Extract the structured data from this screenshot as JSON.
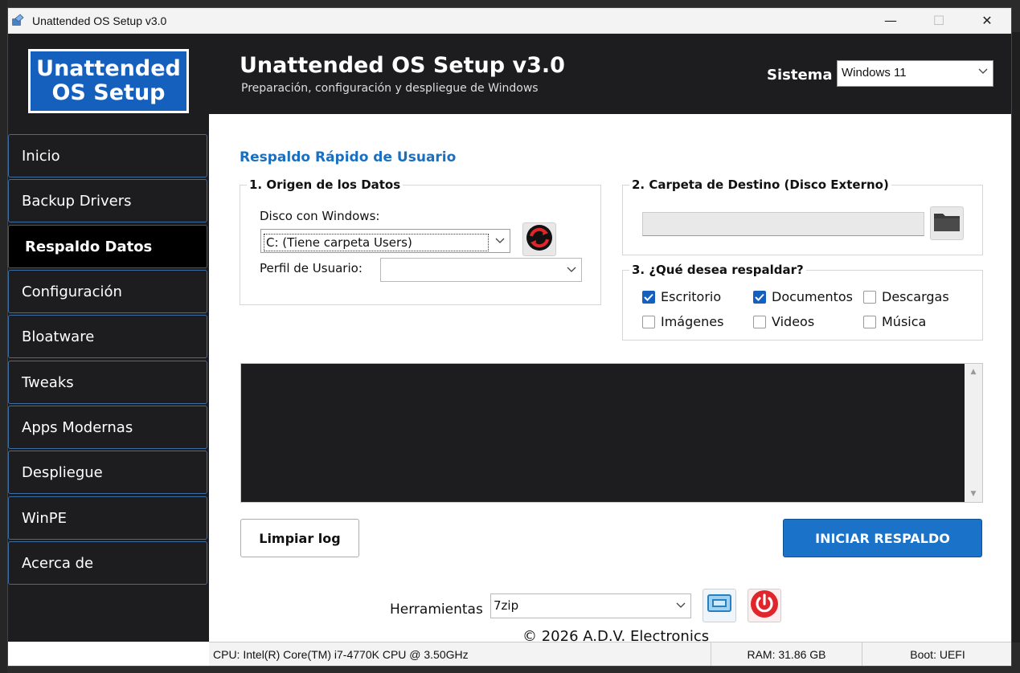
{
  "window": {
    "title": "Unattended OS Setup v3.0",
    "minimize_glyph": "—",
    "maximize_glyph": "☐",
    "close_glyph": "✕"
  },
  "header": {
    "logo_line1": "Unattended",
    "logo_line2": "OS Setup",
    "title": "Unattended OS Setup v3.0",
    "subtitle": "Preparación, configuración y despliegue de Windows",
    "system_label": "Sistema",
    "system_value": "Windows 11"
  },
  "sidebar": {
    "items": [
      {
        "label": "Inicio"
      },
      {
        "label": "Backup Drivers"
      },
      {
        "label": "Respaldo Datos"
      },
      {
        "label": "Configuración"
      },
      {
        "label": "Bloatware"
      },
      {
        "label": "Tweaks"
      },
      {
        "label": "Apps Modernas"
      },
      {
        "label": "Despliegue"
      },
      {
        "label": "WinPE"
      },
      {
        "label": "Acerca de"
      }
    ],
    "active_index": 2
  },
  "main": {
    "section_title": "Respaldo Rápido de Usuario",
    "origin": {
      "legend": "1. Origen de los Datos",
      "disk_label": "Disco con Windows:",
      "disk_value": "C: (Tiene carpeta Users)",
      "profile_label": "Perfil de Usuario:",
      "profile_value": ""
    },
    "destination": {
      "legend": "2. Carpeta de Destino (Disco Externo)",
      "path_value": ""
    },
    "what": {
      "legend": "3. ¿Qué desea respaldar?",
      "options": [
        {
          "label": "Escritorio",
          "checked": true
        },
        {
          "label": "Documentos",
          "checked": true
        },
        {
          "label": "Descargas",
          "checked": false
        },
        {
          "label": "Imágenes",
          "checked": false
        },
        {
          "label": "Videos",
          "checked": false
        },
        {
          "label": "Música",
          "checked": false
        }
      ]
    },
    "clear_log_label": "Limpiar log",
    "start_backup_label": "INICIAR RESPALDO",
    "tools_label": "Herramientas",
    "tools_value": "7zip",
    "copyright": "© 2026 A.D.V. Electronics"
  },
  "status": {
    "cpu": "CPU: Intel(R) Core(TM) i7-4770K CPU @ 3.50GHz",
    "ram": "RAM: 31.86 GB",
    "boot": "Boot: UEFI"
  },
  "colors": {
    "accent": "#1a73c9",
    "dark": "#1d1d1f",
    "section_title": "#1a6fbf",
    "power_red": "#e0262b"
  },
  "icons": [
    "app-icon",
    "refresh-icon",
    "folder-icon",
    "window-tool-icon",
    "power-icon",
    "chevron-down-icon",
    "check-icon"
  ]
}
